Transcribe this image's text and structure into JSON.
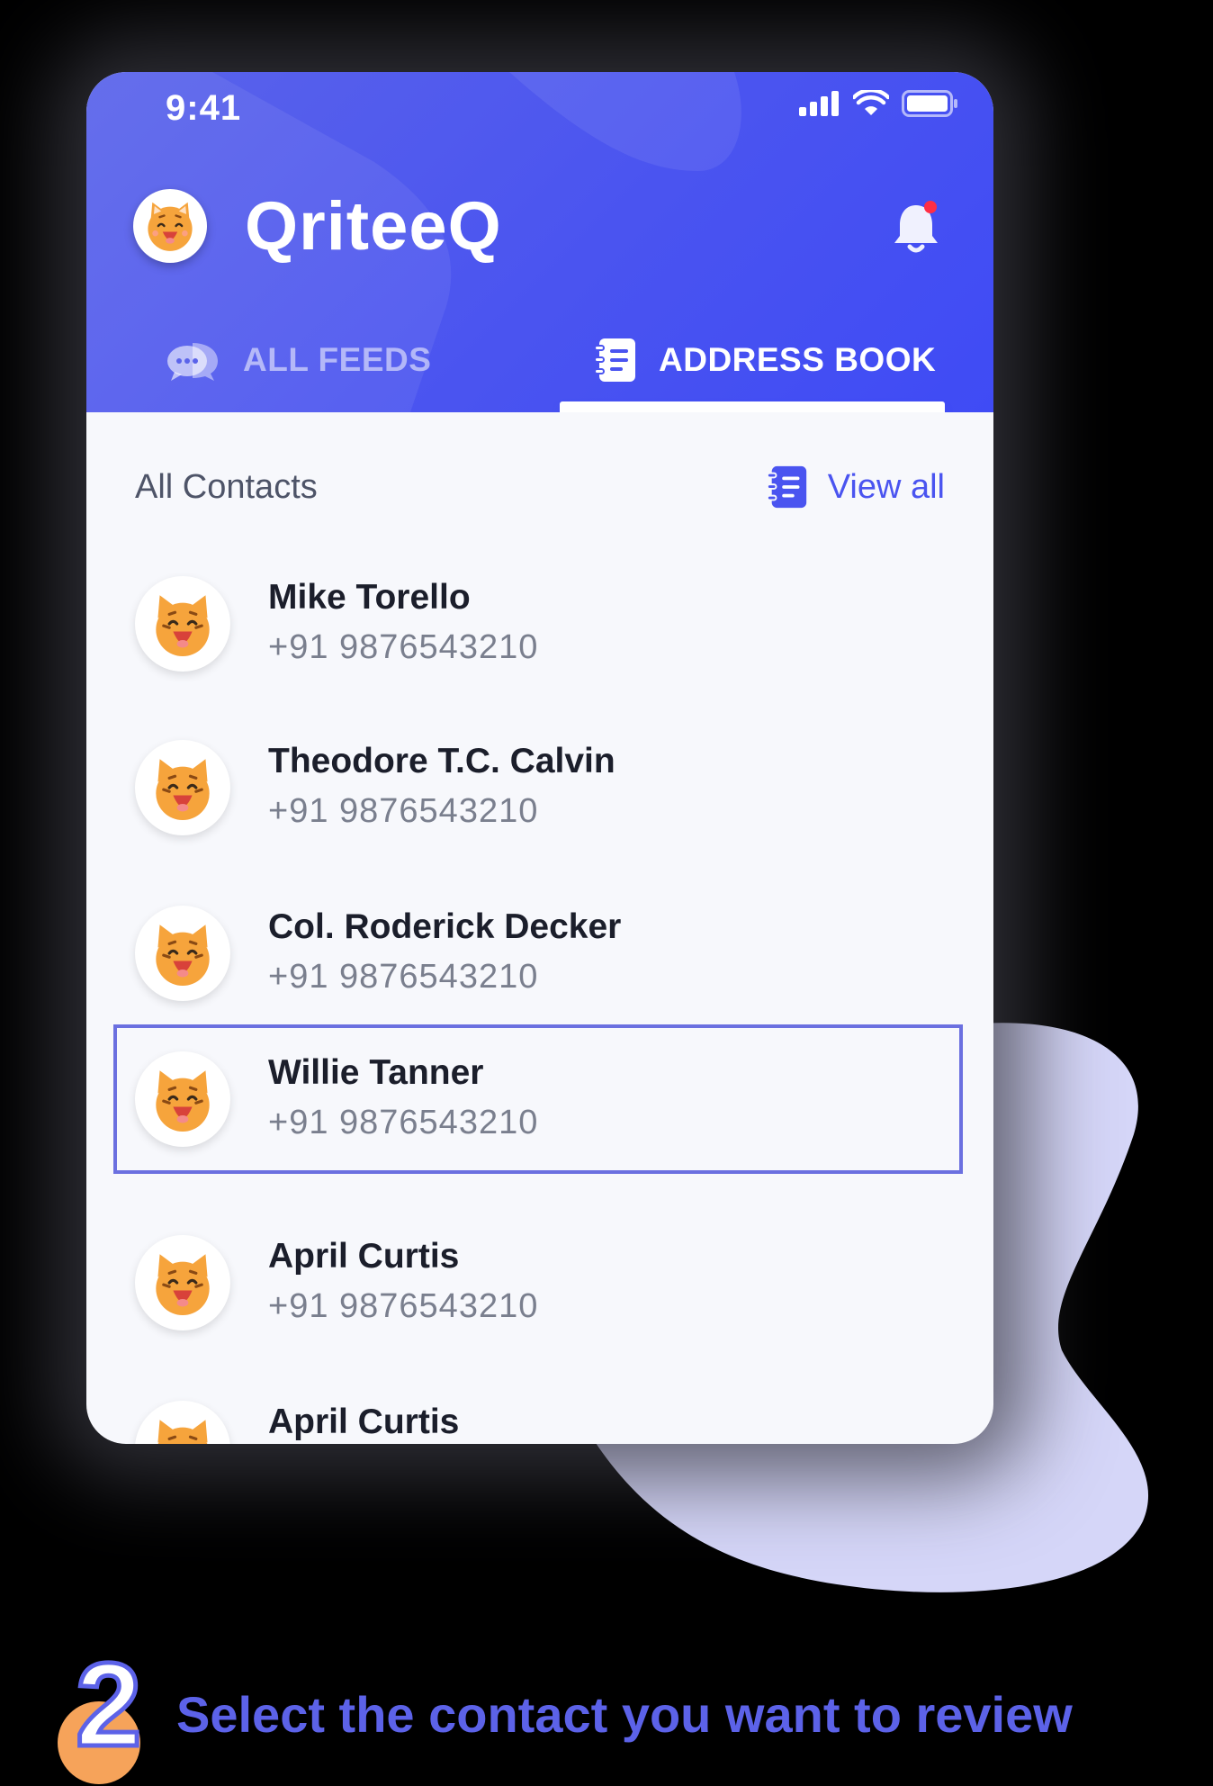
{
  "status_bar": {
    "time": "9:41"
  },
  "app": {
    "name": "QriteeQ"
  },
  "tabs": [
    {
      "label": "ALL FEEDS",
      "active": false,
      "icon": "chat-bubbles-icon"
    },
    {
      "label": "ADDRESS BOOK",
      "active": true,
      "icon": "address-book-icon"
    }
  ],
  "section": {
    "title": "All Contacts",
    "view_all_label": "View all"
  },
  "contacts": [
    {
      "name": "Mike Torello",
      "phone": "+91 9876543210",
      "selected": false
    },
    {
      "name": "Theodore T.C. Calvin",
      "phone": "+91 9876543210",
      "selected": false
    },
    {
      "name": "Col. Roderick Decker",
      "phone": "+91 9876543210",
      "selected": false
    },
    {
      "name": "Willie Tanner",
      "phone": "+91 9876543210",
      "selected": true
    },
    {
      "name": "April Curtis",
      "phone": "+91 9876543210",
      "selected": false
    },
    {
      "name": "April Curtis",
      "phone": "",
      "selected": false
    }
  ],
  "step": {
    "number": "2",
    "instruction": "Select the contact you want to review"
  },
  "colors": {
    "primary": "#4a54f0",
    "accent_orange": "#f6a35a",
    "blob": "#d5d6f8"
  }
}
